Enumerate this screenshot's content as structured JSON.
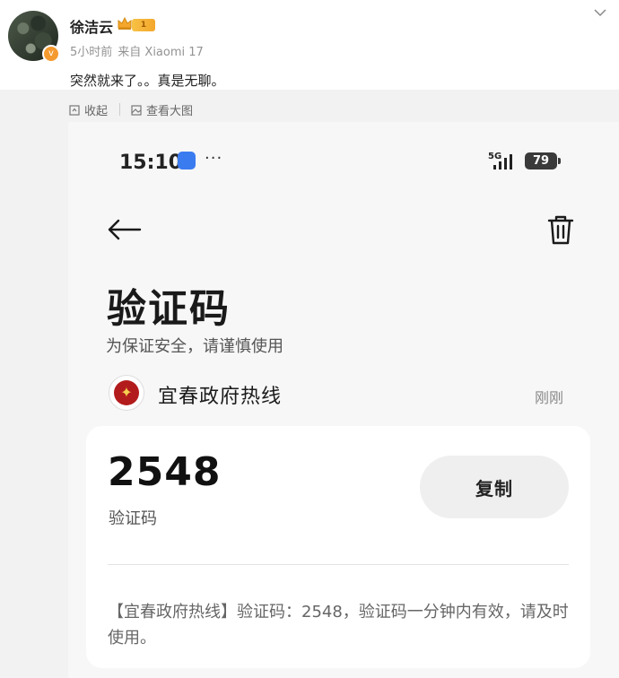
{
  "post": {
    "username": "徐洁云",
    "level_badge": "1",
    "time": "5小时前",
    "source": "来自 Xiaomi 17",
    "text": "突然就来了。。真是无聊。",
    "verify_badge": "v"
  },
  "actions": {
    "collapse": "收起",
    "view_large": "查看大图"
  },
  "screenshot": {
    "status_time": "15:10",
    "status_more": "···",
    "network": "5G",
    "battery": "79",
    "title": "验证码",
    "subtitle": "为保证安全，请谨慎使用",
    "sender_name": "宜春政府热线",
    "sender_time": "刚刚",
    "code": "2548",
    "code_label": "验证码",
    "copy_label": "复制",
    "message": "【宜春政府热线】验证码：2548，验证码一分钟内有效，请及时使用。"
  },
  "icons": [
    "crown-icon",
    "chevron-down-icon",
    "collapse-icon",
    "image-icon",
    "back-icon",
    "trash-icon",
    "signal-icon",
    "battery-icon"
  ]
}
